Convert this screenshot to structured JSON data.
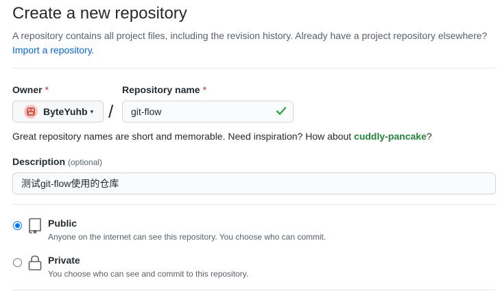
{
  "header": {
    "title": "Create a new repository",
    "subtitle": "A repository contains all project files, including the revision history. Already have a project repository elsewhere?",
    "import_link": "Import a repository."
  },
  "owner": {
    "label": "Owner",
    "required_mark": "*",
    "value": "ByteYuhb",
    "caret": "▾"
  },
  "separator": "/",
  "repo_name": {
    "label": "Repository name",
    "required_mark": "*",
    "value": "git-flow",
    "valid_color": "#28a745"
  },
  "hint": {
    "text": "Great repository names are short and memorable. Need inspiration? How about ",
    "suggestion": "cuddly-pancake",
    "suffix": "?"
  },
  "description": {
    "label": "Description",
    "optional": "(optional)",
    "value": "测试git-flow使用的仓库"
  },
  "visibility": {
    "public": {
      "title": "Public",
      "note": "Anyone on the internet can see this repository. You choose who can commit.",
      "selected": true
    },
    "private": {
      "title": "Private",
      "note": "You choose who can see and commit to this repository.",
      "selected": false
    }
  }
}
